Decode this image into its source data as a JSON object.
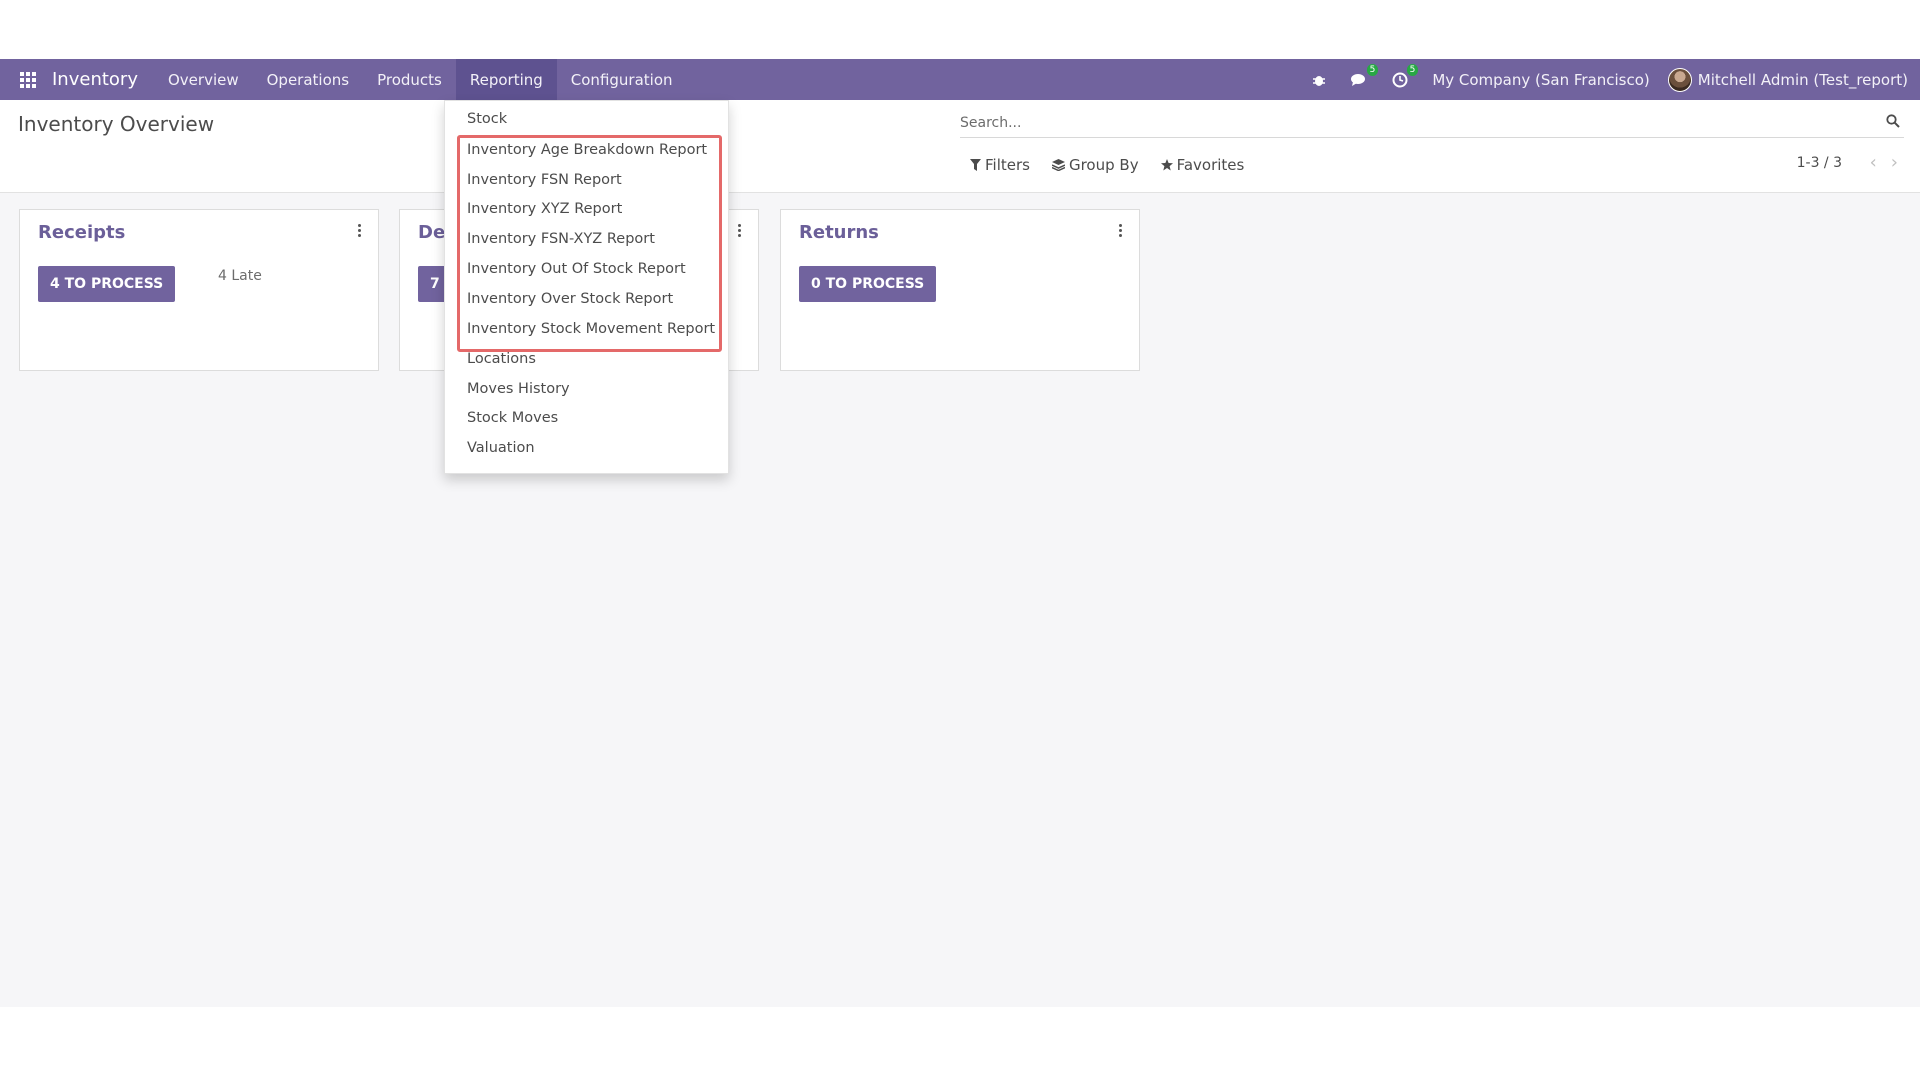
{
  "navbar": {
    "brand": "Inventory",
    "menus": [
      "Overview",
      "Operations",
      "Products",
      "Reporting",
      "Configuration"
    ],
    "active_menu": "Reporting",
    "chat_badge": "5",
    "activity_badge": "5",
    "company": "My Company (San Francisco)",
    "user": "Mitchell Admin (Test_report)"
  },
  "control_panel": {
    "title": "Inventory Overview",
    "search_placeholder": "Search...",
    "filters_label": "Filters",
    "group_by_label": "Group By",
    "favorites_label": "Favorites",
    "pager": "1-3 / 3"
  },
  "cards": [
    {
      "title": "Receipts",
      "button": "4 TO PROCESS",
      "late": "4 Late"
    },
    {
      "title": "De",
      "button": "7"
    },
    {
      "title": "Returns",
      "button": "0 TO PROCESS"
    }
  ],
  "reporting_menu": {
    "items": [
      "Stock",
      "Inventory Age Breakdown Report",
      "Inventory FSN Report",
      "Inventory XYZ Report",
      "Inventory FSN-XYZ Report",
      "Inventory Out Of Stock Report",
      "Inventory Over Stock Report",
      "Inventory Stock Movement Report",
      "Locations",
      "Moves History",
      "Stock Moves",
      "Valuation"
    ]
  },
  "colors": {
    "navbar": "#71639e",
    "accent_button": "#71639e",
    "highlight_border": "#e46969",
    "badge": "#28a745"
  }
}
